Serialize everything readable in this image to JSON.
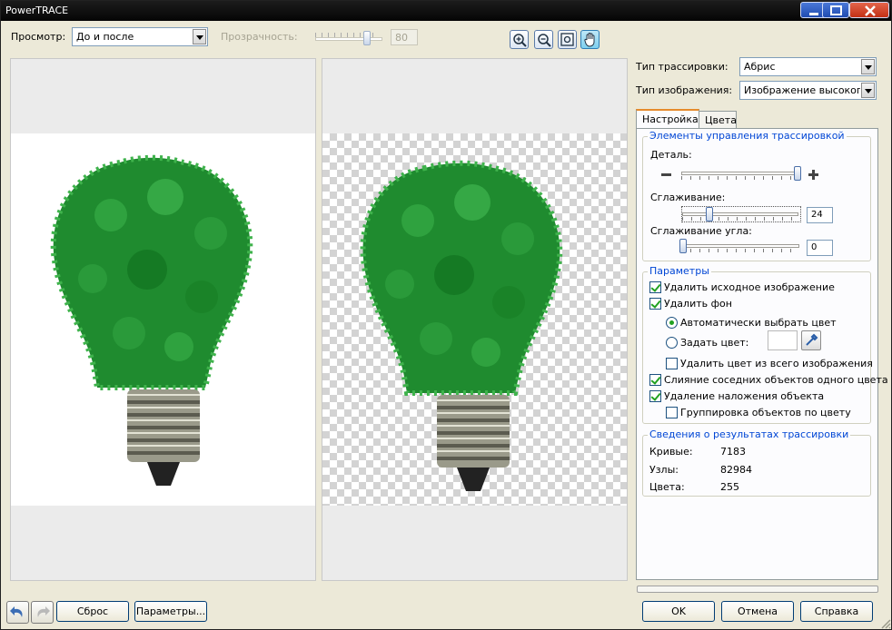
{
  "window": {
    "title": "PowerTRACE"
  },
  "toolbar": {
    "preview_label": "Просмотр:",
    "preview_value": "До и после",
    "transparency_label": "Прозрачность:",
    "transparency_value": "80",
    "transparency_level": 0.8
  },
  "tools": [
    {
      "name": "zoom-in-icon"
    },
    {
      "name": "zoom-out-icon"
    },
    {
      "name": "fit-icon"
    },
    {
      "name": "pan-hand-icon",
      "active": true
    }
  ],
  "trace": {
    "type_label": "Тип трассировки:",
    "type_value": "Абрис",
    "image_type_label": "Тип изображения:",
    "image_type_value": "Изображение высокого к"
  },
  "tabs": [
    {
      "label": "Настройка",
      "active": true
    },
    {
      "label": "Цвета"
    }
  ],
  "controls": {
    "group_title": "Элементы управления трассировкой",
    "detail_label": "Деталь:",
    "detail_level": 1.0,
    "smoothing_label": "Сглаживание:",
    "smoothing_value": "24",
    "corner_label": "Сглаживание угла:",
    "corner_value": "0"
  },
  "options": {
    "group_title": "Параметры",
    "delete_original": "Удалить исходное изображение",
    "remove_background": "Удалить фон",
    "auto_color": "Автоматически выбрать цвет",
    "set_color": "Задать цвет:",
    "remove_color_all": "Удалить цвет из всего изображения",
    "merge_adjacent": "Слияние соседних объектов одного цвета",
    "remove_overlap": "Удаление наложения объекта",
    "group_by_color": "Группировка объектов по цвету"
  },
  "results": {
    "group_title": "Сведения о результатах трассировки",
    "curves_label": "Кривые:",
    "curves_value": "7183",
    "nodes_label": "Узлы:",
    "nodes_value": "82984",
    "colors_label": "Цвета:",
    "colors_value": "255"
  },
  "buttons": {
    "reset": "Сброс",
    "params": "Параметры...",
    "ok": "OK",
    "cancel": "Отмена",
    "help": "Справка"
  },
  "colors": {
    "accent": "#0046d5",
    "tree_green": "#1e8a2e",
    "tab_highlight": "#e68b2c"
  }
}
